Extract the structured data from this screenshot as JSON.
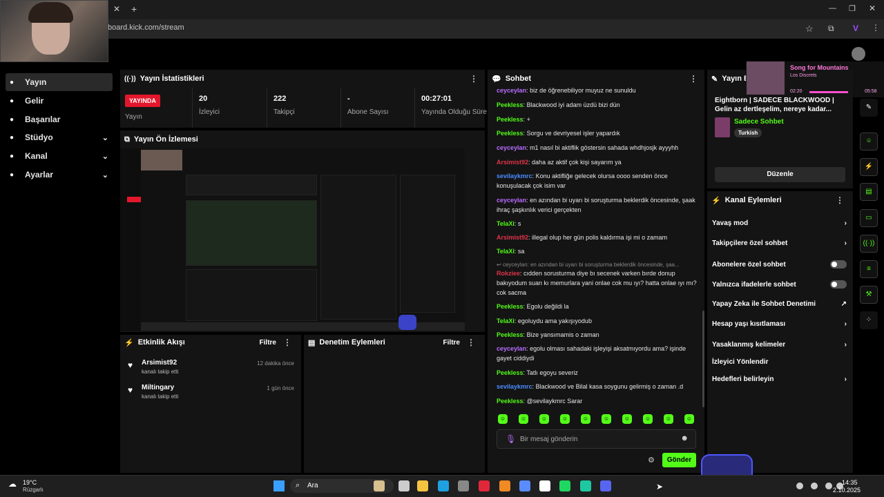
{
  "browser": {
    "url": "board.kick.com/stream"
  },
  "nav": {
    "items": [
      {
        "label": "Yayın",
        "icon": "broadcast-icon"
      },
      {
        "label": "Gelir",
        "icon": "wallet-icon"
      },
      {
        "label": "Başarılar",
        "icon": "trophy-icon"
      },
      {
        "label": "Stüdyo",
        "icon": "studio-icon"
      },
      {
        "label": "Kanal",
        "icon": "channel-icon"
      },
      {
        "label": "Ayarlar",
        "icon": "gear-icon"
      }
    ]
  },
  "stats": {
    "title": "Yayın İstatistikleri",
    "live_badge": "YAYINDA",
    "live_label": "Yayın",
    "items": [
      {
        "value": "20",
        "label": "İzleyici"
      },
      {
        "value": "222",
        "label": "Takipçi"
      },
      {
        "value": "-",
        "label": "Abone Sayısı"
      },
      {
        "value": "00:27:01",
        "label": "Yayında Olduğu Süre"
      }
    ]
  },
  "preview": {
    "title": "Yayın Ön İzlemesi"
  },
  "activity": {
    "title": "Etkinlik Akışı",
    "filter": "Filtre",
    "items": [
      {
        "user": "Arsimist92",
        "action": "kanalı takip etti",
        "time": "12 dakika önce"
      },
      {
        "user": "Miltingary",
        "action": "kanalı takip etti",
        "time": "1 gün önce"
      }
    ]
  },
  "moderation": {
    "title": "Denetim Eylemleri",
    "filter": "Filtre"
  },
  "chat": {
    "title": "Sohbet",
    "placeholder": "Bir mesaj gönderin",
    "send": "Gönder",
    "messages": [
      {
        "user": "ceyceylan",
        "color": "#b96cff",
        "text": "biz de öğrenebiliyor muyuz ne sunuldu"
      },
      {
        "user": "Peekless",
        "color": "#53fc18",
        "text": "Blackwood iyi adam üzdü bizi dün"
      },
      {
        "user": "Peekless",
        "color": "#53fc18",
        "text": "+"
      },
      {
        "user": "Peekless",
        "color": "#53fc18",
        "text": "Sorgu ve devriyesel işler yapardık"
      },
      {
        "user": "ceyceylan",
        "color": "#b96cff",
        "text": "m1 nasıl bi aktiflik göstersin sahada whdhjosjk ayyyhh"
      },
      {
        "user": "Arsimist92",
        "color": "#e0344a",
        "text": "daha az aktif çok kişi sayarım ya"
      },
      {
        "user": "sevilaykmrc",
        "color": "#4a8cff",
        "text": "Konu aktifliğe gelecek olursa oooo senden önce konuşulacak çok isim var"
      },
      {
        "user": "ceyceylan",
        "color": "#b96cff",
        "text": "en azından bi uyarı bi soruşturma beklerdik öncesinde, şaak ihraç şaşkınlık verici gerçekten"
      },
      {
        "user": "TelaXi",
        "color": "#53fc18",
        "text": "s"
      },
      {
        "user": "Arsimist92",
        "color": "#e0344a",
        "text": "illegal olup her gün polis kaldırma işi mi o zamam"
      },
      {
        "user": "TelaXi",
        "color": "#53fc18",
        "text": "sa"
      },
      {
        "user": "",
        "color": "#888",
        "text": "ceyceylan: en azından bi uyarı bi soruşturma beklerdik öncesinde, şaa..."
      },
      {
        "user": "Rokziee",
        "color": "#e0344a",
        "text": "cıdden sorusturma diye bı secenek varken bırde donup bakıyodum suan kı memurlara yani onlae cok mu ıyı? hatta onlae ıyı mı? cok sacma"
      },
      {
        "user": "Peekless",
        "color": "#53fc18",
        "text": "Egolu değildi la"
      },
      {
        "user": "TelaXi",
        "color": "#53fc18",
        "text": "egoluydu ama yakışıyodub"
      },
      {
        "user": "Peekless",
        "color": "#53fc18",
        "text": "Bize yansımamis o zaman"
      },
      {
        "user": "ceyceylan",
        "color": "#b96cff",
        "text": "egolu olması sahadaki işleyişi aksatmıyordu ama? işinde gayet ciddiydi"
      },
      {
        "user": "Peekless",
        "color": "#53fc18",
        "text": "Tatlı egoyu severiz"
      },
      {
        "user": "sevilaykmrc",
        "color": "#4a8cff",
        "text": "Blackwood ve Bilal kasa soygunu gelirmiş o zaman .d"
      },
      {
        "user": "Peekless",
        "color": "#53fc18",
        "text": "@sevilaykmrc Sarar"
      }
    ]
  },
  "info": {
    "title": "Yayın Bi",
    "stream_title": "Eightborn | SADECE BLACKWOOD | Gelin az dertleşelim, nereye kadar...",
    "category": "Sadece Sohbet",
    "tag": "Turkish",
    "edit": "Düzenle"
  },
  "music": {
    "song": "Song for Mountains",
    "artist": "Los Discrets",
    "elapsed": "02:20",
    "total": "05:58"
  },
  "actions": {
    "title": "Kanal Eylemleri",
    "items": [
      {
        "label": "Yavaş mod",
        "type": "chevron"
      },
      {
        "label": "Takipçilere özel sohbet",
        "type": "chevron"
      },
      {
        "label": "Abonelere özel sohbet",
        "type": "toggle"
      },
      {
        "label": "Yalnızca ifadelerle sohbet",
        "type": "toggle"
      },
      {
        "label": "Yapay Zeka ile Sohbet Denetimi",
        "type": "external"
      },
      {
        "label": "Hesap yaşı kısıtlaması",
        "type": "chevron"
      },
      {
        "label": "Yasaklanmış kelimeler",
        "type": "chevron"
      },
      {
        "label": "İzleyici Yönlendir",
        "type": "none"
      },
      {
        "label": "Hedefleri belirleyin",
        "type": "chevron"
      }
    ]
  },
  "taskbar": {
    "temp": "19°C",
    "weather": "Rüzgarlı",
    "search": "Ara",
    "time": "14:35",
    "date": "2.10.2025"
  }
}
